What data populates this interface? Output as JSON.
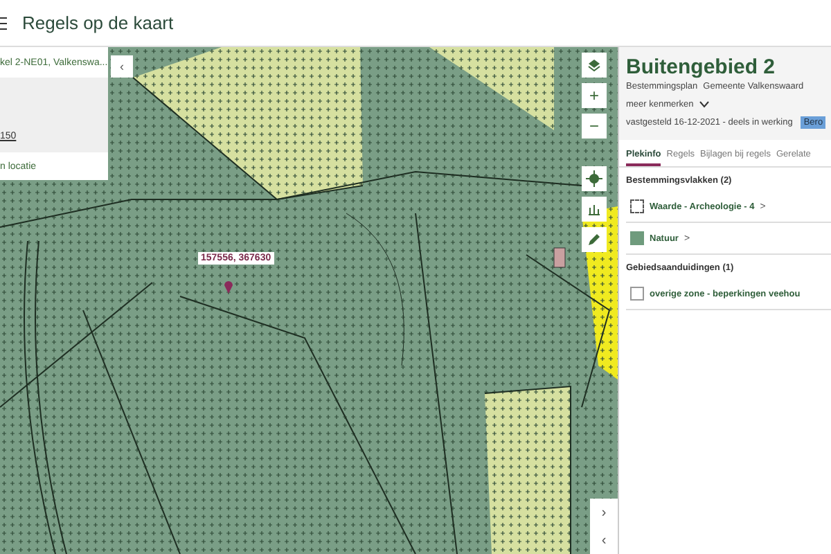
{
  "header": {
    "title": "Regels op de kaart"
  },
  "location_panel": {
    "address": "kel 2-NE01, Valkenswa...",
    "link": "150",
    "action": "n locatie"
  },
  "map": {
    "coordinate_label": "157556, 367630",
    "collapse": "‹",
    "zoom_in": "+",
    "zoom_out": "−",
    "next": "›",
    "previous": "‹"
  },
  "plan": {
    "title": "Buitengebied 2",
    "type": "Bestemmingsplan",
    "authority": "Gemeente Valkenswaard",
    "more": "meer kenmerken",
    "status": "vastgesteld 16-12-2021 - deels in werking",
    "badge": "Bero"
  },
  "tabs": [
    {
      "label": "Plekinfo",
      "selected": true
    },
    {
      "label": "Regels",
      "selected": false
    },
    {
      "label": "Bijlagen bij regels",
      "selected": false
    },
    {
      "label": "Gerelate",
      "selected": false
    }
  ],
  "sections": [
    {
      "title": "Bestemmingsvlakken (2)",
      "items": [
        {
          "label": "Waarde - Archeologie - 4",
          "kind": "dashed",
          "arrow": ">"
        },
        {
          "label": "Natuur",
          "kind": "filled",
          "color": "#6f9b7d",
          "arrow": ">"
        }
      ]
    },
    {
      "title": "Gebiedsaanduidingen (1)",
      "items": [
        {
          "label": "overige zone - beperkingen veehou",
          "kind": "outline"
        }
      ]
    }
  ]
}
